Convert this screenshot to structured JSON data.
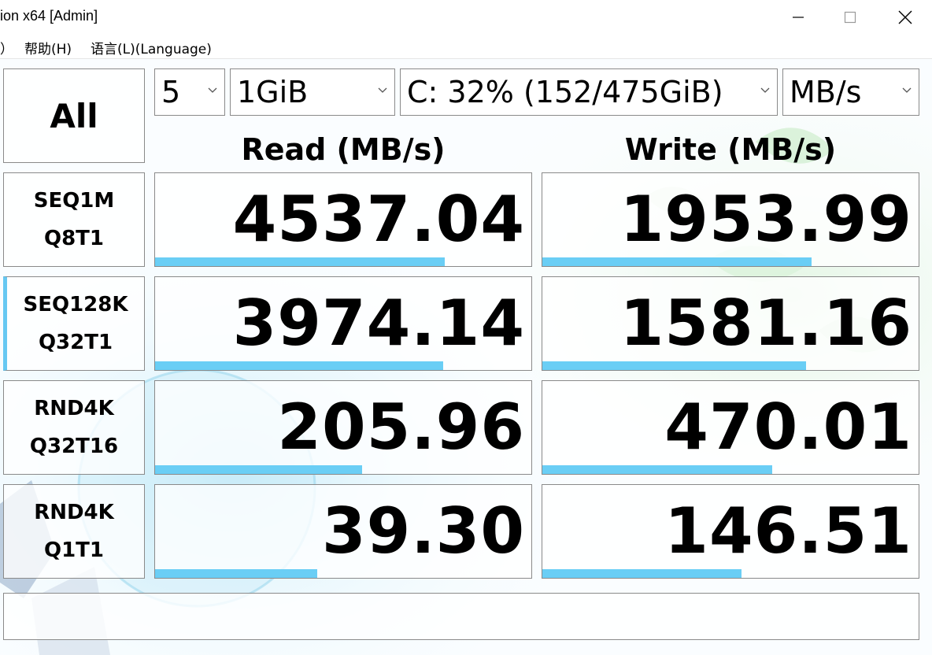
{
  "window": {
    "title": "ion x64 [Admin]"
  },
  "menu": {
    "items": [
      "）",
      "帮助(H)",
      "语言(L)(Language)"
    ]
  },
  "controls": {
    "all_label": "All",
    "test_count": "5",
    "test_size": "1GiB",
    "drive": "C: 32% (152/475GiB)",
    "unit": "MB/s"
  },
  "headers": {
    "read": "Read (MB/s)",
    "write": "Write (MB/s)"
  },
  "tests": [
    {
      "line1": "SEQ1M",
      "line2": "Q8T1",
      "read": "4537.04",
      "write": "1953.99",
      "read_fill": 0.77,
      "write_fill": 0.715
    },
    {
      "line1": "SEQ128K",
      "line2": "Q32T1",
      "read": "3974.14",
      "write": "1581.16",
      "read_fill": 0.766,
      "write_fill": 0.7
    },
    {
      "line1": "RND4K",
      "line2": "Q32T16",
      "read": "205.96",
      "write": "470.01",
      "read_fill": 0.55,
      "write_fill": 0.61
    },
    {
      "line1": "RND4K",
      "line2": "Q1T1",
      "read": "39.30",
      "write": "146.51",
      "read_fill": 0.43,
      "write_fill": 0.53
    }
  ],
  "status_text": "",
  "colors": {
    "bar": "#6acef5",
    "border": "#8a8a8a"
  },
  "icons": [
    "minimize-icon",
    "maximize-icon",
    "close-icon",
    "chevron-down-icon"
  ]
}
